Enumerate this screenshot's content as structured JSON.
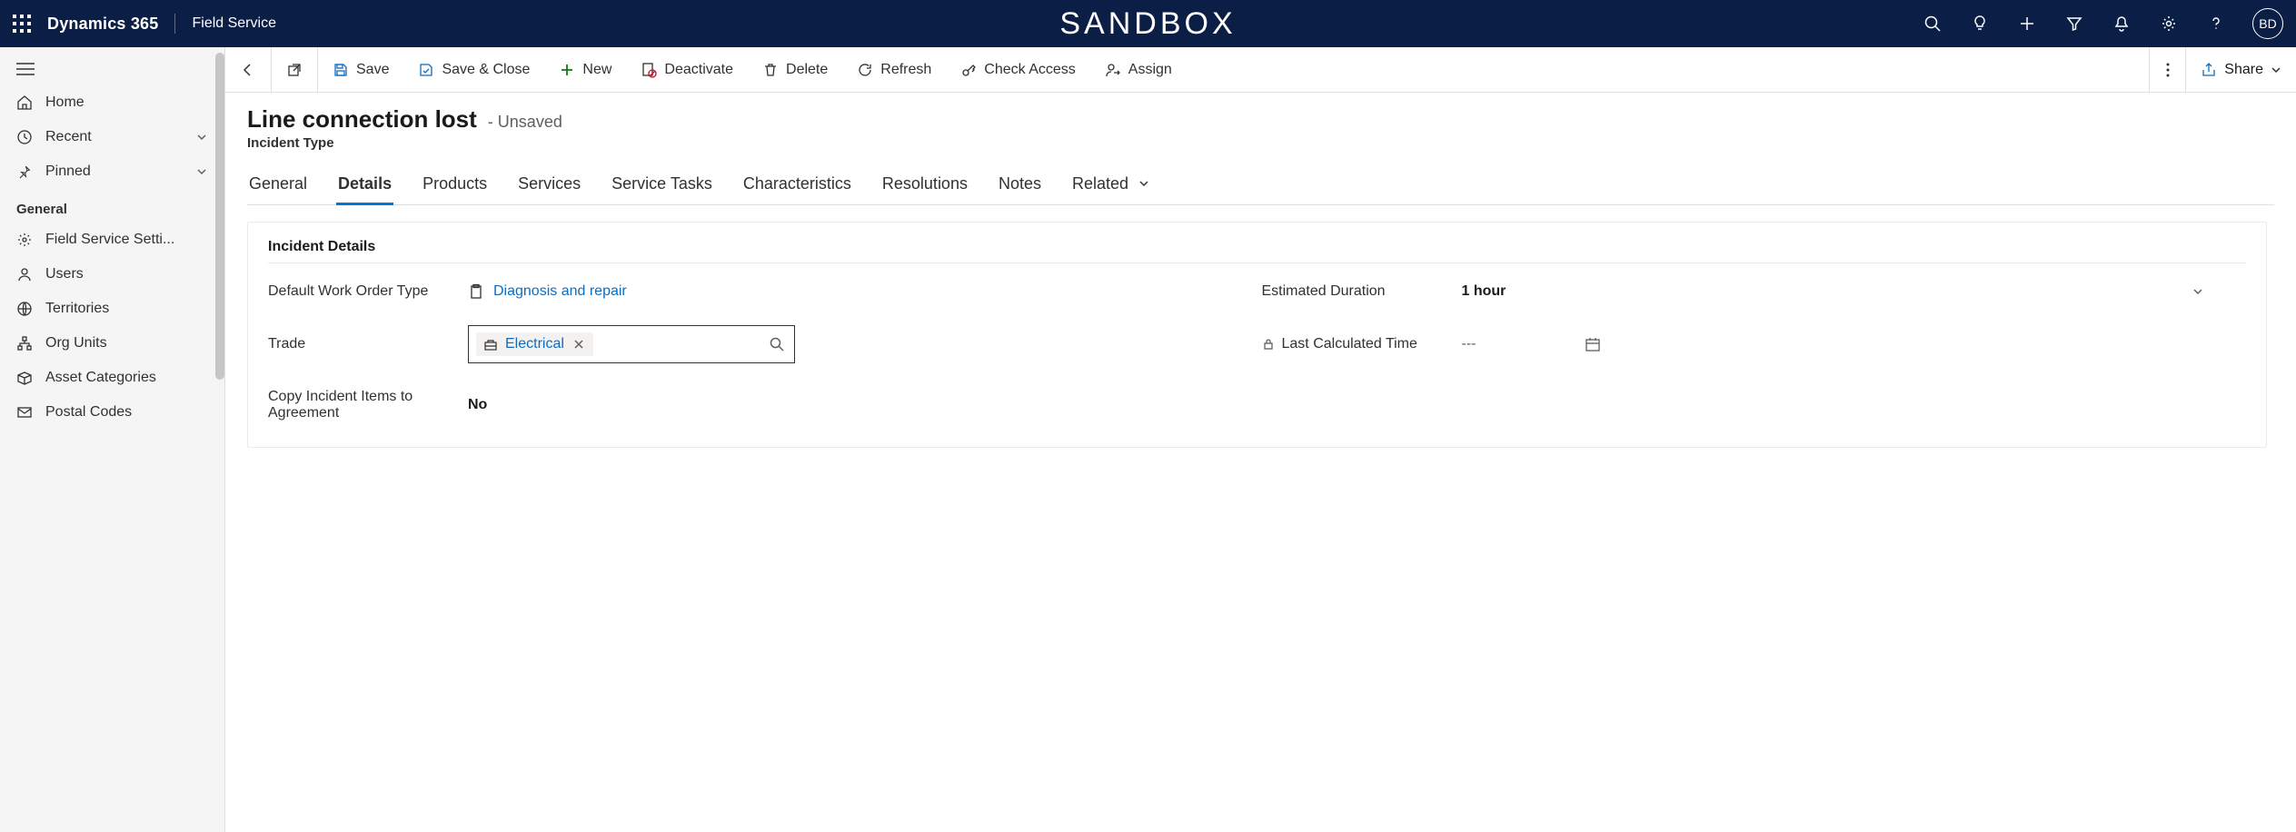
{
  "header": {
    "brand": "Dynamics 365",
    "app_name": "Field Service",
    "environment_label": "SANDBOX",
    "avatar_initials": "BD"
  },
  "sidebar": {
    "items_top": [
      {
        "label": "Home"
      },
      {
        "label": "Recent"
      },
      {
        "label": "Pinned"
      }
    ],
    "section_label": "General",
    "items_general": [
      {
        "label": "Field Service Setti..."
      },
      {
        "label": "Users"
      },
      {
        "label": "Territories"
      },
      {
        "label": "Org Units"
      },
      {
        "label": "Asset Categories"
      },
      {
        "label": "Postal Codes"
      }
    ]
  },
  "commandbar": {
    "save": "Save",
    "save_close": "Save & Close",
    "new": "New",
    "deactivate": "Deactivate",
    "delete": "Delete",
    "refresh": "Refresh",
    "check_access": "Check Access",
    "assign": "Assign",
    "share": "Share"
  },
  "record": {
    "title": "Line connection lost",
    "state_suffix": "- Unsaved",
    "entity": "Incident Type"
  },
  "tabs": [
    {
      "label": "General"
    },
    {
      "label": "Details",
      "active": true
    },
    {
      "label": "Products"
    },
    {
      "label": "Services"
    },
    {
      "label": "Service Tasks"
    },
    {
      "label": "Characteristics"
    },
    {
      "label": "Resolutions"
    },
    {
      "label": "Notes"
    },
    {
      "label": "Related",
      "has_chevron": true
    }
  ],
  "form": {
    "section_title": "Incident Details",
    "default_work_order_type": {
      "label": "Default Work Order Type",
      "value": "Diagnosis and repair"
    },
    "trade": {
      "label": "Trade",
      "value": "Electrical"
    },
    "copy_items": {
      "label": "Copy Incident Items to Agreement",
      "value": "No"
    },
    "estimated_duration": {
      "label": "Estimated Duration",
      "value": "1 hour"
    },
    "last_calculated": {
      "label": "Last Calculated Time",
      "value": "---"
    }
  }
}
